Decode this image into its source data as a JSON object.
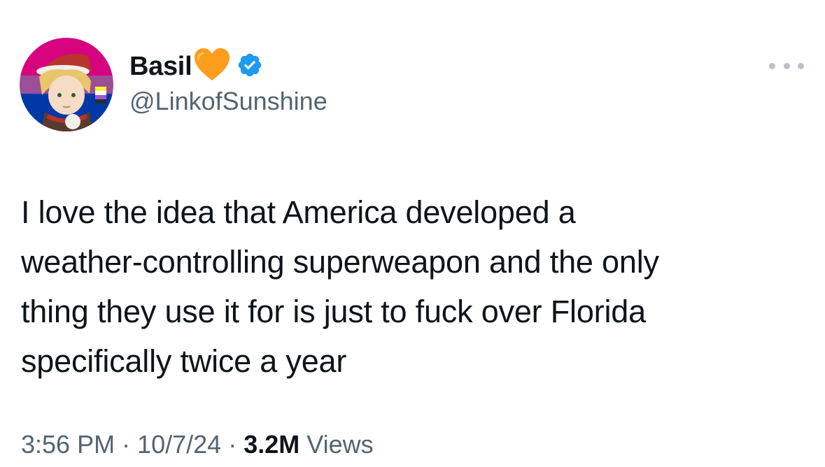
{
  "author": {
    "display_name": "Basil",
    "handle": "@LinkofSunshine",
    "verified": true,
    "emoji": "orange-heart"
  },
  "tweet": {
    "lines": [
      "I love the idea that America developed a",
      "weather-controlling superweapon and the only",
      "thing they use it for is just to fuck over Florida",
      "specifically twice a year"
    ]
  },
  "meta": {
    "time": "3:56 PM",
    "separator": "·",
    "date": "10/7/24",
    "views_count": "3.2M",
    "views_label": "Views"
  },
  "colors": {
    "text": "#0f1419",
    "secondary": "#536471",
    "verified": "#1d9bf0",
    "heart": "#ff9d1c"
  }
}
